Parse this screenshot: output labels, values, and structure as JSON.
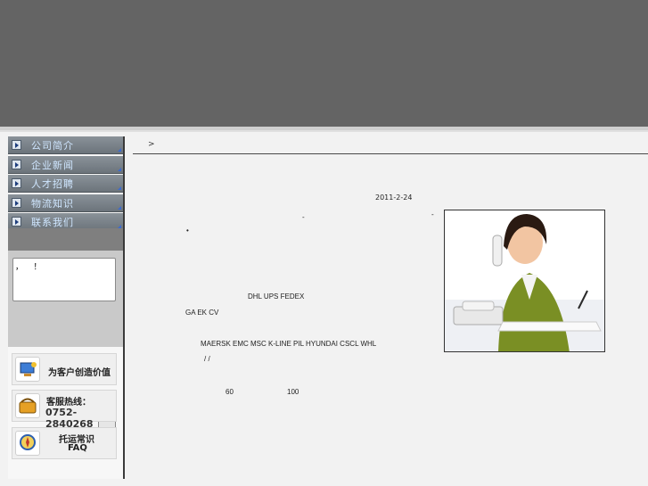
{
  "sidebar": {
    "menu": [
      {
        "label": "公司简介"
      },
      {
        "label": "企业新闻"
      },
      {
        "label": "人才招聘"
      },
      {
        "label": "物流知识"
      },
      {
        "label": "联系我们"
      }
    ],
    "message_text": "，    ！",
    "promos": [
      {
        "icon": "monitor-icon",
        "line1": "为客户创造价值",
        "line2": ""
      },
      {
        "icon": "phone-icon",
        "line1": "客服热线：",
        "line2": "0752-2840268"
      },
      {
        "icon": "compass-icon",
        "line1": "托运常识",
        "line2": "FAQ"
      }
    ]
  },
  "content": {
    "breadcrumb": ">",
    "date": "2011-2-24",
    "dash1": "-",
    "dash2": "-",
    "dot": "•",
    "carriers1": "DHL UPS FEDEX",
    "carriers2": "GA EK CV",
    "shipping_lines": "MAERSK EMC MSC K-LINE PIL HYUNDAI CSCL WHL",
    "slashes": "/ /",
    "num1": "60",
    "num2": "100"
  }
}
